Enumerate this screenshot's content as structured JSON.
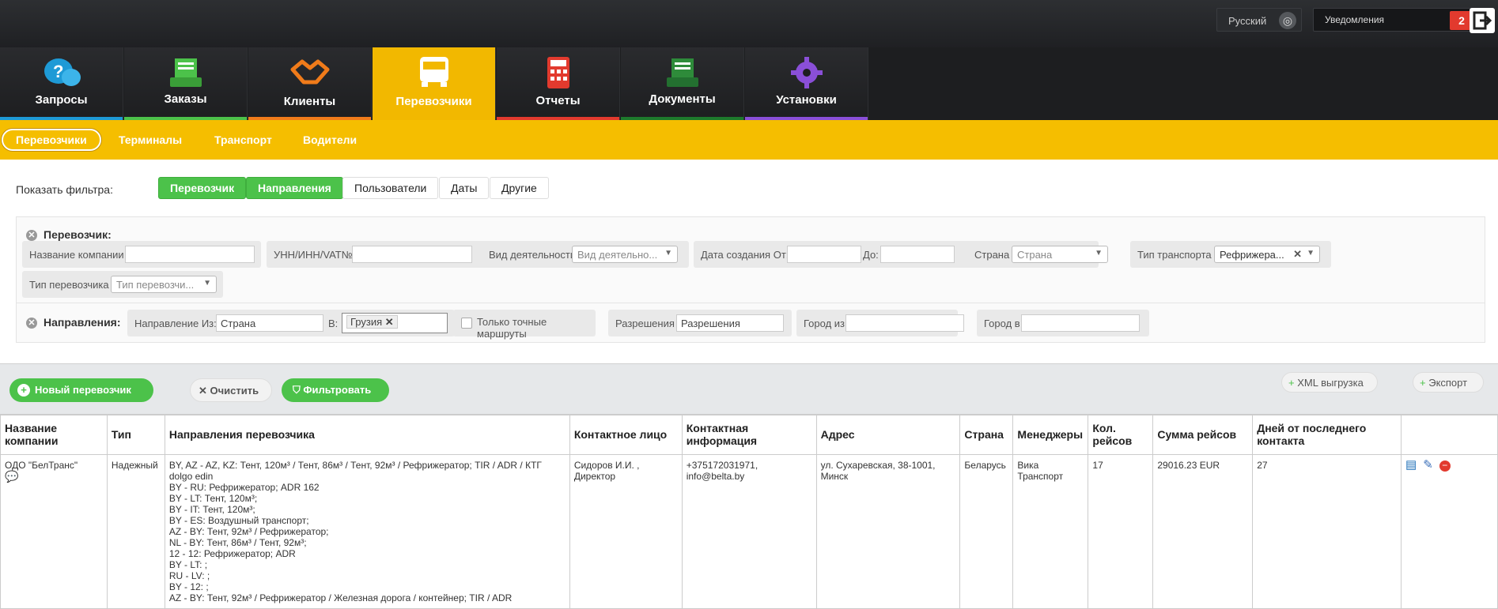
{
  "header": {
    "language": "Русский",
    "notifications_label": "Уведомления",
    "notifications_count": "2"
  },
  "nav": {
    "tabs": [
      {
        "label": "Запросы",
        "icon": "question-chat-icon",
        "color": "#1e9ad6"
      },
      {
        "label": "Заказы",
        "icon": "inbox-tray-icon",
        "color": "#4cc24a"
      },
      {
        "label": "Клиенты",
        "icon": "handshake-icon",
        "color": "#f07b1a"
      },
      {
        "label": "Перевозчики",
        "icon": "truck-icon",
        "color": "#f2b800"
      },
      {
        "label": "Отчеты",
        "icon": "calculator-icon",
        "color": "#e23a2e"
      },
      {
        "label": "Документы",
        "icon": "document-tray-icon",
        "color": "#2e8b3a"
      },
      {
        "label": "Установки",
        "icon": "gear-icon",
        "color": "#8a4fd8"
      }
    ],
    "active_index": 3
  },
  "subnav": {
    "items": [
      "Перевозчики",
      "Терминалы",
      "Транспорт",
      "Водители"
    ]
  },
  "filters": {
    "show_label": "Показать фильтра:",
    "toggles": [
      "Перевозчик",
      "Направления",
      "Пользователи",
      "Даты",
      "Другие"
    ],
    "carrier_section": "Перевозчик:",
    "company_name_label": "Название компании",
    "vat_label": "УНН/ИНН/VAT№",
    "activity_label": "Вид деятельности",
    "activity_placeholder": "Вид деятельно...",
    "date_from_label": "Дата создания От:",
    "date_to_label": "До:",
    "country_label": "Страна",
    "country_placeholder": "Страна",
    "transport_type_label": "Тип транспорта",
    "transport_type_value": "Рефрижера...",
    "carrier_type_label": "Тип перевозчика",
    "carrier_type_placeholder": "Тип перевозчи...",
    "directions_section": "Направления:",
    "direction_from_label": "Направление Из:",
    "direction_from_value": "Страна",
    "direction_to_label": "В:",
    "direction_to_value": "Грузия",
    "exact_routes_label": "Только точные маршруты",
    "permits_label": "Разрешения",
    "permits_placeholder": "Разрешения",
    "city_from_label": "Город из",
    "city_to_label": "Город в"
  },
  "actions": {
    "new_carrier": "Новый перевозчик",
    "clear": "Очистить",
    "filter": "Фильтровать",
    "xml_export": "XML выгрузка",
    "export": "Экспорт"
  },
  "table": {
    "headers": [
      "Название компании",
      "Тип",
      "Направления перевозчика",
      "Контактное лицо",
      "Контактная информация",
      "Адрес",
      "Страна",
      "Менеджеры",
      "Кол. рейсов",
      "Сумма рейсов",
      "Дней от последнего контакта",
      ""
    ],
    "row": {
      "company": "ОДО \"БелТранс\"",
      "type": "Надежный",
      "directions": [
        "BY, AZ - AZ, KZ: Тент, 120м³ / Тент, 86м³ / Тент, 92м³ / Рефрижератор; TIR / ADR / КТГ",
        "dolgo edin",
        "BY - RU: Рефрижератор; ADR 162",
        "BY - LT: Тент, 120м³;",
        "BY - IT: Тент, 120м³;",
        "BY - ES: Воздушный транспорт;",
        "AZ - BY: Тент, 92м³ / Рефрижератор;",
        "NL - BY: Тент, 86м³ / Тент, 92м³;",
        "12 - 12: Рефрижератор; ADR",
        "BY - LT: ;",
        "RU - LV: ;",
        "BY - 12: ;",
        "AZ - BY: Тент, 92м³ / Рефрижератор / Железная дорога / контейнер; TIR / ADR"
      ],
      "contact_person": "Сидоров И.И. , Директор",
      "contact_info": "+375172031971, info@belta.by",
      "address": "ул. Сухаревская, 38-1001, Минск",
      "country": "Беларусь",
      "managers": "Вика Транспорт",
      "trips": "17",
      "sum": "29016.23 EUR",
      "days": "27"
    }
  }
}
